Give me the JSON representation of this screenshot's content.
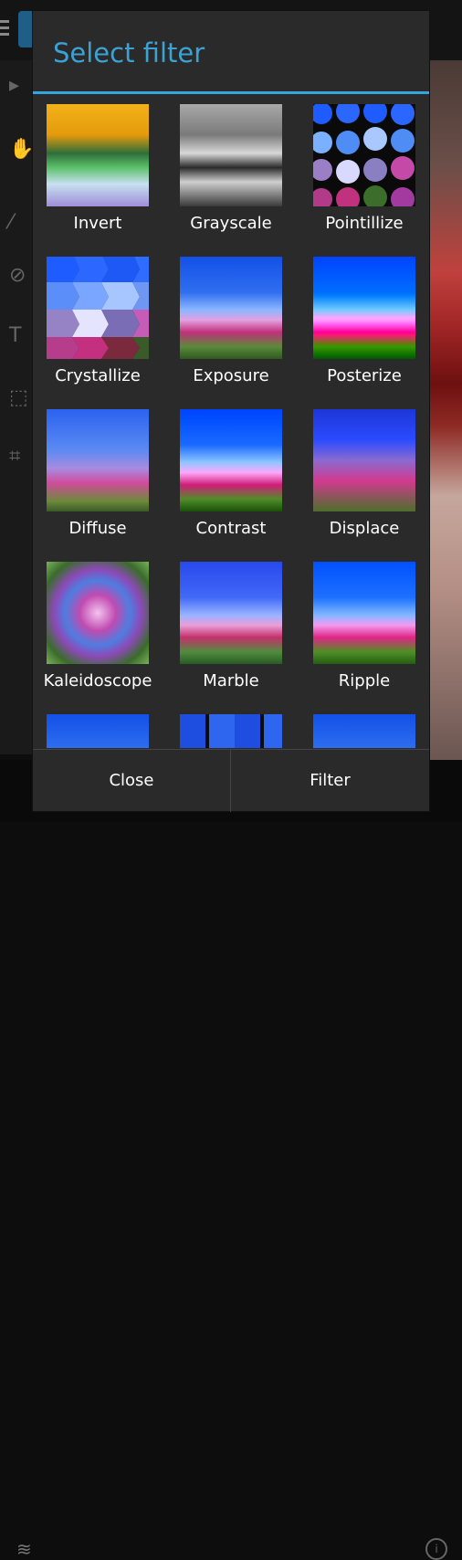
{
  "dialog": {
    "title": "Select filter",
    "filters": [
      {
        "label": "Invert"
      },
      {
        "label": "Grayscale"
      },
      {
        "label": "Pointillize"
      },
      {
        "label": "Crystallize"
      },
      {
        "label": "Exposure"
      },
      {
        "label": "Posterize"
      },
      {
        "label": "Diffuse"
      },
      {
        "label": "Contrast"
      },
      {
        "label": "Displace"
      },
      {
        "label": "Kaleidoscope"
      },
      {
        "label": "Marble"
      },
      {
        "label": "Ripple"
      },
      {
        "label": ""
      },
      {
        "label": ""
      },
      {
        "label": ""
      }
    ],
    "buttons": {
      "close_label": "Close",
      "filter_label": "Filter"
    }
  },
  "colors": {
    "accent": "#33a6dd",
    "dialog_background": "#2a2a2a",
    "text": "#ffffff"
  },
  "icons": {
    "background_app": [
      "menu-icon",
      "app-logo-icon",
      "select-arrow-icon",
      "hand-icon",
      "brush-icon",
      "eraser-icon",
      "text-icon",
      "selection-icon",
      "crop-icon",
      "layers-icon",
      "info-icon"
    ]
  }
}
